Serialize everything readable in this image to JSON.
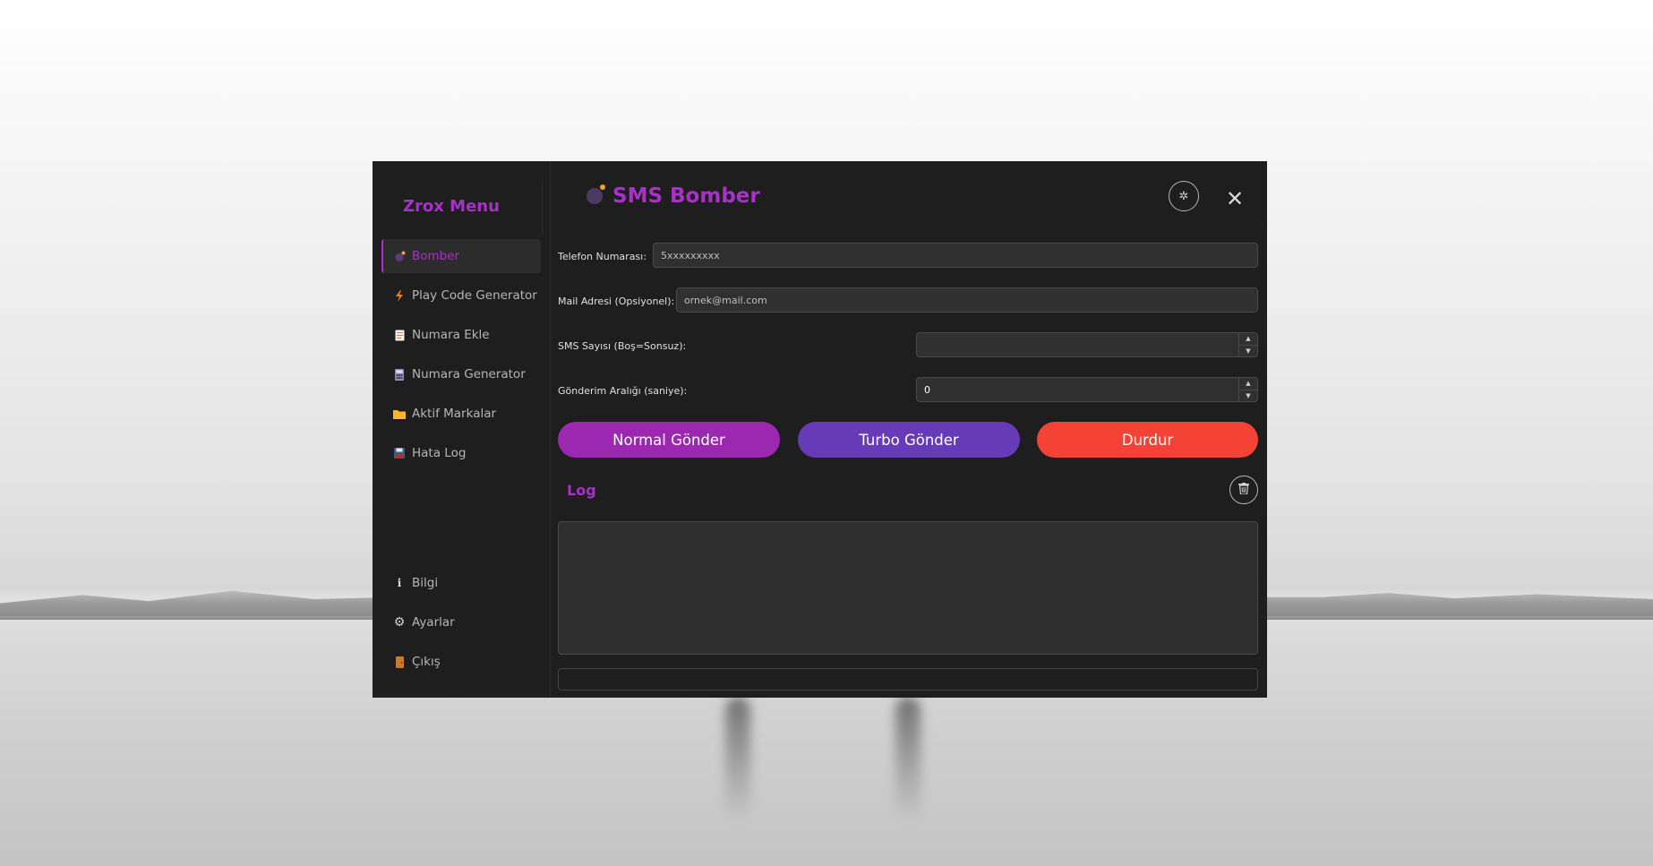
{
  "app": {
    "brand": "Zrox Menu",
    "title": "SMS Bomber"
  },
  "sidebar": {
    "items": [
      {
        "label": "Bomber",
        "icon": "bomb-icon",
        "active": true
      },
      {
        "label": "Play Code Generator",
        "icon": "lightning-icon"
      },
      {
        "label": "Numara Ekle",
        "icon": "document-icon"
      },
      {
        "label": "Numara Generator",
        "icon": "calculator-icon"
      },
      {
        "label": "Aktif Markalar",
        "icon": "folder-icon"
      },
      {
        "label": "Hata Log",
        "icon": "floppy-disk-icon"
      }
    ],
    "bottom_items": [
      {
        "label": "Bilgi",
        "icon": "info-icon"
      },
      {
        "label": "Ayarlar",
        "icon": "gear-icon"
      },
      {
        "label": "Çıkış",
        "icon": "door-icon"
      }
    ]
  },
  "form": {
    "phone_label": "Telefon Numarası:",
    "phone_placeholder": "5xxxxxxxxx",
    "mail_label": "Mail Adresi (Opsiyonel):",
    "mail_placeholder": "ornek@mail.com",
    "sms_count_label": "SMS Sayısı (Boş=Sonsuz):",
    "sms_count_value": "",
    "interval_label": "Gönderim Aralığı (saniye):",
    "interval_value": "0"
  },
  "buttons": {
    "normal": "Normal Gönder",
    "turbo": "Turbo Gönder",
    "stop": "Durdur"
  },
  "log": {
    "label": "Log",
    "content": ""
  },
  "colors": {
    "accent": "#a930c8",
    "normal_button": "#9c27b0",
    "turbo_button": "#673ab7",
    "stop_button": "#f44336",
    "window_bg": "#1e1e1f"
  }
}
